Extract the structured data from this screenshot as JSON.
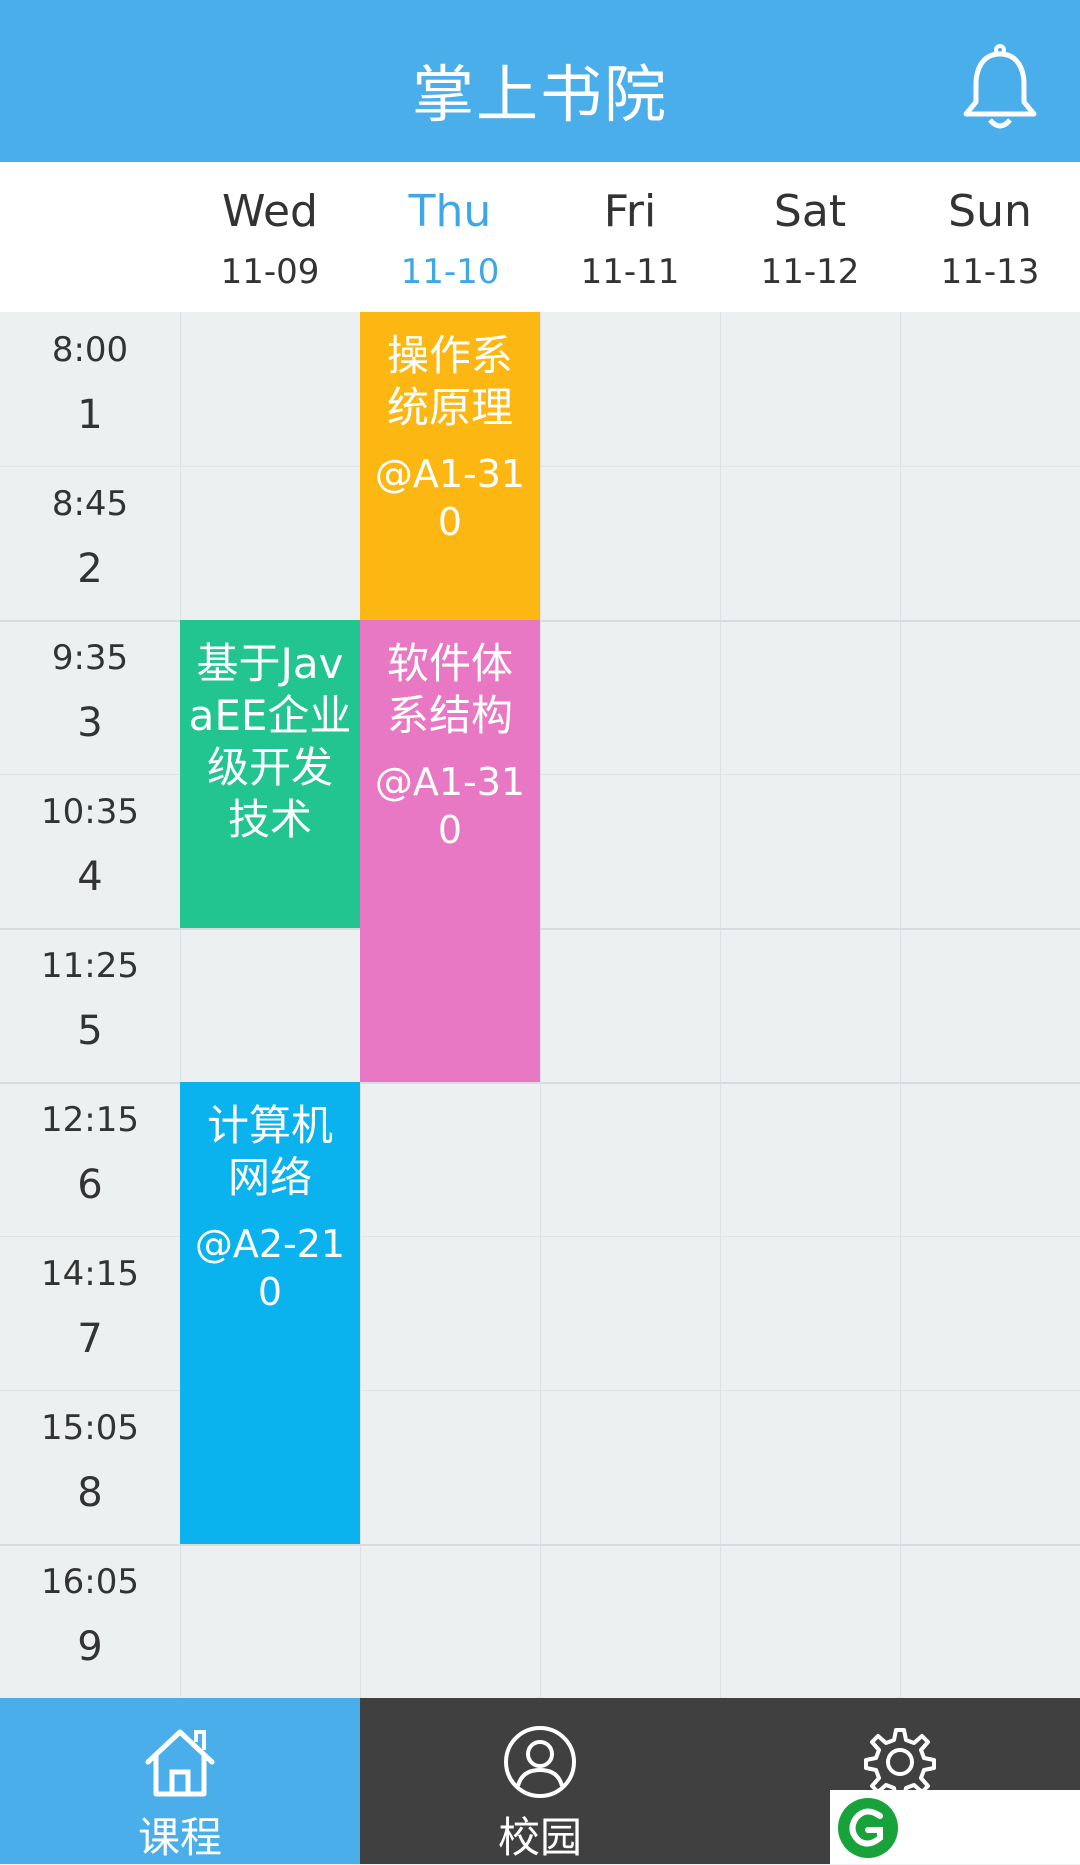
{
  "header": {
    "title": "掌上书院",
    "bell_icon": "bell-icon"
  },
  "days": [
    {
      "name": "Wed",
      "date": "11-09"
    },
    {
      "name": "Thu",
      "date": "11-10"
    },
    {
      "name": "Fri",
      "date": "11-11"
    },
    {
      "name": "Sat",
      "date": "11-12"
    },
    {
      "name": "Sun",
      "date": "11-13"
    }
  ],
  "active_day": "Thu",
  "periods": [
    {
      "time": "8:00",
      "num": "1"
    },
    {
      "time": "8:45",
      "num": "2"
    },
    {
      "time": "9:35",
      "num": "3"
    },
    {
      "time": "10:35",
      "num": "4"
    },
    {
      "time": "11:25",
      "num": "5"
    },
    {
      "time": "12:15",
      "num": "6"
    },
    {
      "time": "14:15",
      "num": "7"
    },
    {
      "time": "15:05",
      "num": "8"
    },
    {
      "time": "16:05",
      "num": "9"
    }
  ],
  "courses": [
    {
      "name": "操作系统原理",
      "room": "@A1-310",
      "day": "Thu",
      "start": 1,
      "end": 2,
      "color": "#fcb712"
    },
    {
      "name": "基于JavaEE企业级开发技术",
      "room": "",
      "day": "Wed",
      "start": 3,
      "end": 4,
      "color": "#22c48f"
    },
    {
      "name": "软件体系结构",
      "room": "@A1-310",
      "day": "Thu",
      "start": 3,
      "end": 5,
      "color": "#e878c3"
    },
    {
      "name": "计算机网络",
      "room": "@A2-210",
      "day": "Wed",
      "start": 6,
      "end": 8,
      "color": "#0ab2ee"
    }
  ],
  "nav": {
    "tabs": [
      {
        "label": "课程",
        "icon": "home-icon"
      },
      {
        "label": "校园",
        "icon": "user-icon"
      },
      {
        "label": "",
        "icon": "gear-icon"
      }
    ]
  },
  "colors": {
    "primary": "#4aaeea",
    "nav_dark": "#404040",
    "active_day": "#3ea8e6"
  }
}
